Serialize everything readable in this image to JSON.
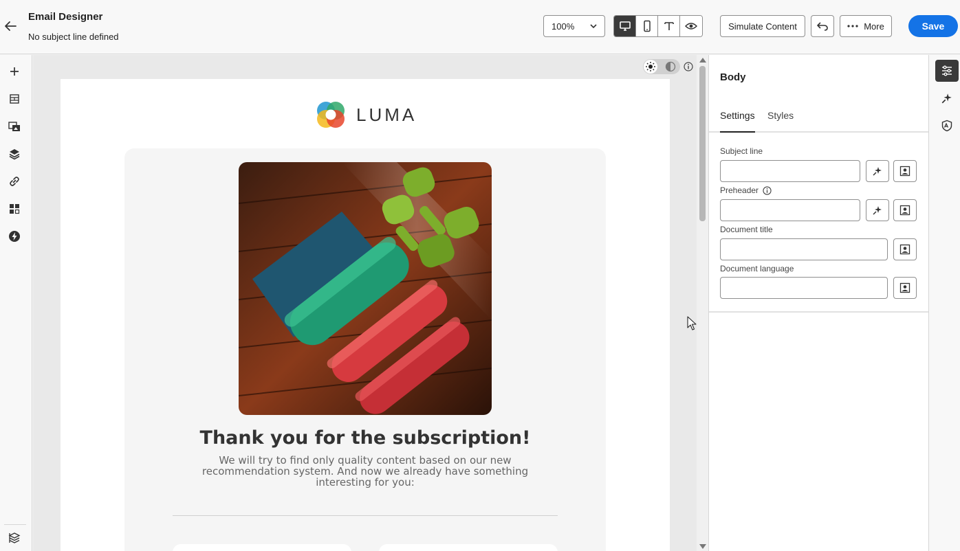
{
  "header": {
    "title": "Email Designer",
    "subtitle": "No subject line defined",
    "zoom_value": "100%",
    "simulate_label": "Simulate Content",
    "more_label": "More",
    "save_label": "Save"
  },
  "email": {
    "logo_text": "LUMA",
    "heading": "Thank you for the subscription!",
    "body_line1": "We will try to find only quality content based on our new",
    "body_line2": "recommendation system. And now we already have something",
    "body_line3": "interesting for you:"
  },
  "panel": {
    "title": "Body",
    "tabs": [
      {
        "label": "Settings",
        "active": true
      },
      {
        "label": "Styles",
        "active": false
      }
    ],
    "fields": {
      "subject_line": {
        "label": "Subject line",
        "value": ""
      },
      "preheader": {
        "label": "Preheader",
        "value": ""
      },
      "document_title": {
        "label": "Document title",
        "value": ""
      },
      "document_language": {
        "label": "Document language",
        "value": ""
      }
    }
  },
  "colors": {
    "accent": "#1473e6",
    "active_dark": "#3a3a3a"
  }
}
